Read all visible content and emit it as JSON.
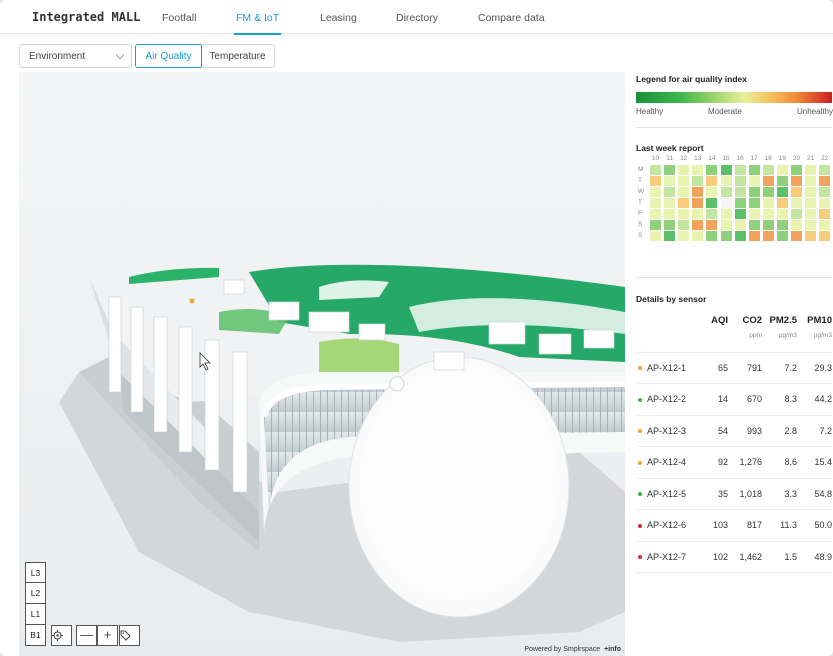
{
  "app": {
    "brand": "Integrated MALL"
  },
  "nav": {
    "tabs": [
      "Footfall",
      "FM & IoT",
      "Leasing",
      "Directory",
      "Compare data"
    ],
    "active": "FM & IoT"
  },
  "toolbar": {
    "environment_select": "Environment",
    "mode_buttons": [
      "Air Quality",
      "Temperature"
    ],
    "active_mode": "Air Quality"
  },
  "map": {
    "levels": [
      "L3",
      "L2",
      "L1",
      "B1"
    ],
    "controls": [
      "locate-icon",
      "zoom-out-icon",
      "zoom-in-icon",
      "tag-icon"
    ],
    "zoom_out_glyph": "—",
    "zoom_in_glyph": "+",
    "powered_by": "Powered by Smplrspace",
    "info_link": "+info"
  },
  "legend": {
    "title": "Legend for air quality index",
    "labels": [
      "Healthy",
      "Moderate",
      "Unhealthy"
    ],
    "colors": [
      "#1a8f3a",
      "#e7ef9a",
      "#cc1f1f"
    ]
  },
  "weekly_report": {
    "title": "Last week report",
    "hours": [
      "10",
      "11",
      "12",
      "13",
      "14",
      "15",
      "16",
      "17",
      "18",
      "19",
      "20",
      "21",
      "22"
    ],
    "days": [
      "M",
      "T",
      "W",
      "T",
      "F",
      "S",
      "S"
    ],
    "color_scale": {
      "0": "#f4f6f7",
      "1": "#c2e6a0",
      "2": "#e8f3b0",
      "3": "#8fd17a",
      "4": "#f7cc7a",
      "5": "#f1a35d",
      "6": "#5cc069"
    },
    "grid": [
      [
        1,
        3,
        2,
        2,
        3,
        6,
        1,
        3,
        1,
        2,
        3,
        2,
        1
      ],
      [
        4,
        2,
        2,
        1,
        4,
        2,
        1,
        2,
        5,
        3,
        5,
        2,
        5
      ],
      [
        2,
        1,
        2,
        5,
        2,
        1,
        1,
        3,
        3,
        6,
        4,
        2,
        1
      ],
      [
        2,
        2,
        4,
        5,
        6,
        0,
        3,
        3,
        2,
        4,
        2,
        2,
        2
      ],
      [
        2,
        2,
        2,
        2,
        1,
        2,
        6,
        2,
        2,
        2,
        1,
        2,
        4
      ],
      [
        3,
        3,
        1,
        5,
        5,
        2,
        2,
        3,
        3,
        3,
        2,
        2,
        2
      ],
      [
        2,
        6,
        2,
        2,
        3,
        3,
        6,
        5,
        5,
        3,
        5,
        4,
        4
      ]
    ]
  },
  "sensors": {
    "title": "Details by sensor",
    "columns": [
      {
        "label": "AQI",
        "unit": ""
      },
      {
        "label": "CO2",
        "unit": "ppm"
      },
      {
        "label": "PM2.5",
        "unit": "µg/m3"
      },
      {
        "label": "PM10",
        "unit": "µg/m3"
      }
    ],
    "rows": [
      {
        "name": "AP-X12-1",
        "aqi": "65",
        "co2": "791",
        "pm25": "7.2",
        "pm10": "29.3",
        "status_color": "#f0a830"
      },
      {
        "name": "AP-X12-2",
        "aqi": "14",
        "co2": "670",
        "pm25": "8.3",
        "pm10": "44.2",
        "status_color": "#3bb54a"
      },
      {
        "name": "AP-X12-3",
        "aqi": "54",
        "co2": "993",
        "pm25": "2.8",
        "pm10": "7.2",
        "status_color": "#f0a830"
      },
      {
        "name": "AP-X12-4",
        "aqi": "92",
        "co2": "1,276",
        "pm25": "8.6",
        "pm10": "15.4",
        "status_color": "#f0a830"
      },
      {
        "name": "AP-X12-5",
        "aqi": "35",
        "co2": "1,018",
        "pm25": "3.3",
        "pm10": "54.8",
        "status_color": "#3bb54a"
      },
      {
        "name": "AP-X12-6",
        "aqi": "103",
        "co2": "817",
        "pm25": "11.3",
        "pm10": "50.0",
        "status_color": "#d9243c"
      },
      {
        "name": "AP-X12-7",
        "aqi": "102",
        "co2": "1,462",
        "pm25": "1.5",
        "pm10": "48.9",
        "status_color": "#d9243c"
      }
    ]
  },
  "theme": {
    "accent": "#1a9bd8"
  }
}
